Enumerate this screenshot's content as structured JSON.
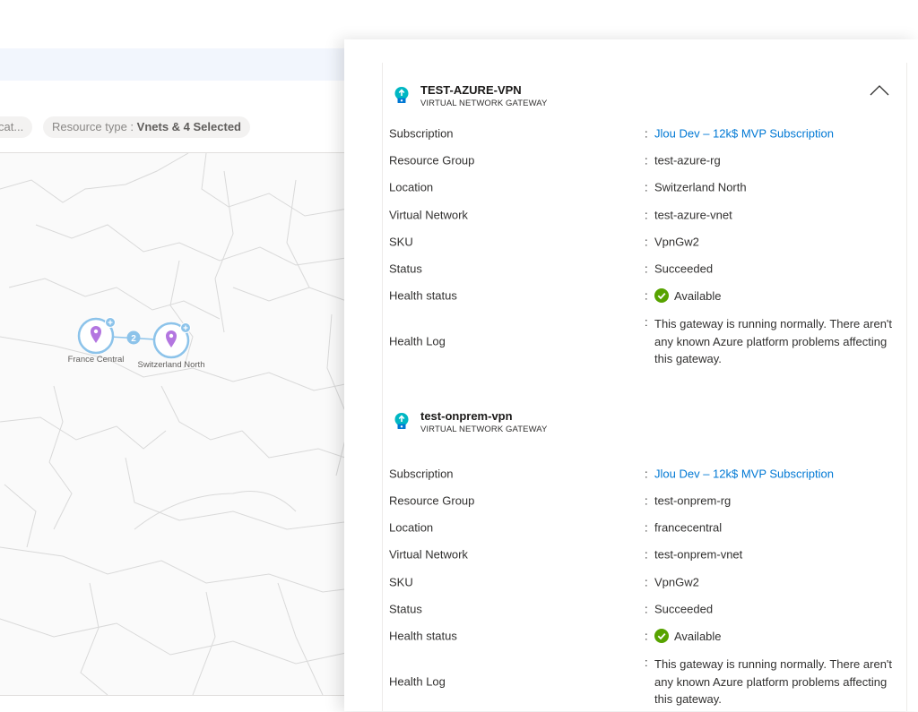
{
  "filters": {
    "location_pill": "cat...",
    "resource_type_label": "Resource type : ",
    "resource_type_value": "Vnets & 4 Selected"
  },
  "map": {
    "locations": [
      {
        "name": "France Central"
      },
      {
        "name": "Switzerland North"
      }
    ],
    "connection_count": "2"
  },
  "gateways": [
    {
      "name": "TEST-AZURE-VPN",
      "type": "VIRTUAL NETWORK GATEWAY",
      "fields": {
        "subscription_label": "Subscription",
        "subscription_value": "Jlou Dev – 12k$ MVP Subscription",
        "resource_group_label": "Resource Group",
        "resource_group_value": "test-azure-rg",
        "location_label": "Location",
        "location_value": "Switzerland North",
        "virtual_network_label": "Virtual Network",
        "virtual_network_value": "test-azure-vnet",
        "sku_label": "SKU",
        "sku_value": "VpnGw2",
        "status_label": "Status",
        "status_value": "Succeeded",
        "health_status_label": "Health status",
        "health_status_value": "Available",
        "health_log_label": "Health Log",
        "health_log_value": "This gateway is running normally. There aren't any known Azure platform problems affecting this gateway."
      }
    },
    {
      "name": "test-onprem-vpn",
      "type": "VIRTUAL NETWORK GATEWAY",
      "fields": {
        "subscription_label": "Subscription",
        "subscription_value": "Jlou Dev – 12k$ MVP Subscription",
        "resource_group_label": "Resource Group",
        "resource_group_value": "test-onprem-rg",
        "location_label": "Location",
        "location_value": "francecentral",
        "virtual_network_label": "Virtual Network",
        "virtual_network_value": "test-onprem-vnet",
        "sku_label": "SKU",
        "sku_value": "VpnGw2",
        "status_label": "Status",
        "status_value": "Succeeded",
        "health_status_label": "Health status",
        "health_status_value": "Available",
        "health_log_label": "Health Log",
        "health_log_value": "This gateway is running normally. There aren't any known Azure platform problems affecting this gateway."
      }
    }
  ],
  "colon": ":",
  "colors": {
    "accent": "#0078d4",
    "success": "#57a300",
    "gateway_icon": "#00b7c3",
    "location_pin": "#b376e0",
    "map_node": "#8cc3ea"
  },
  "icons": {
    "gateway": "vpn-gateway-icon",
    "health": "check-circle-icon",
    "collapse": "chevron-up-icon",
    "pin": "map-pin-icon"
  }
}
